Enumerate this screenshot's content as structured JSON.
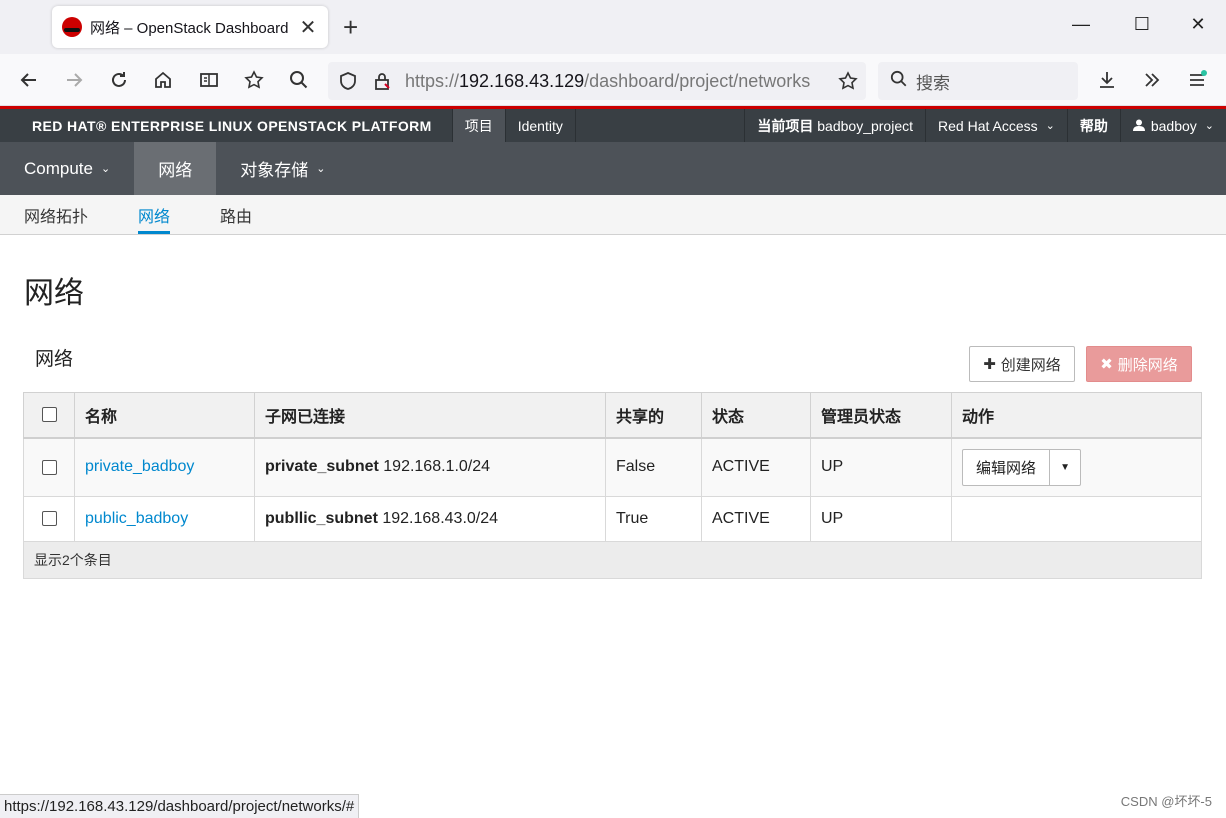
{
  "browser": {
    "tab_title": "网络 – OpenStack Dashboard",
    "tab_close": "✕",
    "new_tab": "+",
    "url_scheme": "https://",
    "url_host": "192.168.43.129",
    "url_path": "/dashboard/project/networks",
    "search_placeholder": "搜索",
    "icons": [
      "back-icon",
      "forward-icon",
      "reload-icon",
      "home-icon",
      "reader-icon",
      "extensions-icon",
      "search-icon",
      "shield-icon",
      "lock-icon",
      "bookmark-star-icon",
      "download-icon",
      "overflow-icon",
      "menu-icon"
    ]
  },
  "header": {
    "brand": "RED HAT® ENTERPRISE LINUX OPENSTACK PLATFORM",
    "tabs": [
      {
        "label": "项目",
        "active": true
      },
      {
        "label": "Identity",
        "active": false
      }
    ],
    "current_project_label": "当前项目",
    "current_project": "badboy_project",
    "red_hat_access": "Red Hat Access",
    "help": "帮助",
    "user": "badboy"
  },
  "nav": {
    "items": [
      {
        "label": "Compute",
        "dropdown": true
      },
      {
        "label": "网络",
        "active": true
      },
      {
        "label": "对象存储",
        "dropdown": true
      }
    ]
  },
  "subnav": {
    "items": [
      {
        "label": "网络拓扑"
      },
      {
        "label": "网络",
        "active": true
      },
      {
        "label": "路由"
      }
    ]
  },
  "page": {
    "title": "网络",
    "table_title": "网络",
    "create_button": "创建网络",
    "delete_button": "删除网络"
  },
  "table": {
    "columns": [
      "名称",
      "子网已连接",
      "共享的",
      "状态",
      "管理员状态",
      "动作"
    ],
    "rows": [
      {
        "name": "private_badboy",
        "subnet_name": "private_subnet",
        "subnet_cidr": "192.168.1.0/24",
        "shared": "False",
        "status": "ACTIVE",
        "admin_state": "UP",
        "action": "编辑网络"
      },
      {
        "name": "public_badboy",
        "subnet_name": "publlic_subnet",
        "subnet_cidr": "192.168.43.0/24",
        "shared": "True",
        "status": "ACTIVE",
        "admin_state": "UP",
        "action": ""
      }
    ],
    "footer": "显示2个条目"
  },
  "statusbar": "https://192.168.43.129/dashboard/project/networks/#",
  "watermark": "CSDN @坏坏-5",
  "colors": {
    "accent_link": "#0088ce",
    "brand_red": "#cc0000",
    "header_bg": "#393f44",
    "nav_bg": "#4d5258",
    "delete_bg": "#e99b9b"
  }
}
